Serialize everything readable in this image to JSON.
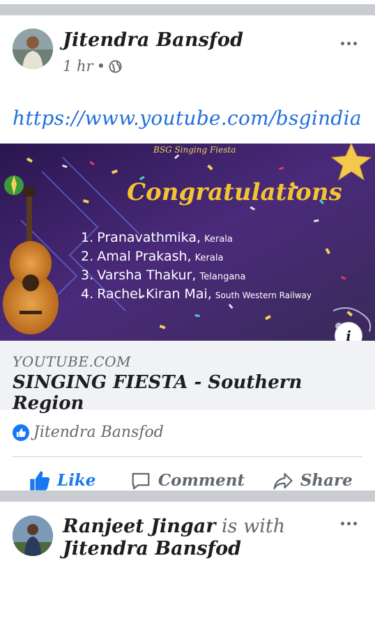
{
  "post": {
    "author": "Jitendra Bansfod",
    "time": "1 hr",
    "separator": "•",
    "link_text": "https://www.youtube.com/bsgindia",
    "preview": {
      "banner_caption": "BSG Singing Fiesta",
      "heading": "Congratulations",
      "winners": [
        {
          "rank": "1.",
          "name": "Pranavathmika,",
          "region": "Kerala"
        },
        {
          "rank": "2.",
          "name": "Amal Prakash,",
          "region": "Kerala"
        },
        {
          "rank": "3.",
          "name": "Varsha Thakur,",
          "region": "Telangana"
        },
        {
          "rank": "4.",
          "name": "Rachel Kiran Mai,",
          "region": "South Western Railway"
        }
      ],
      "info_label": "i"
    },
    "link_domain": "YOUTUBE.COM",
    "link_title": "SINGING FIESTA - Southern Region",
    "reactors": "Jitendra Bansfod",
    "actions": {
      "like": "Like",
      "comment": "Comment",
      "share": "Share"
    },
    "colors": {
      "accent": "#1877f2",
      "link": "#216fdb",
      "secondary": "#65676b"
    }
  },
  "next_post": {
    "author": "Ranjeet Jingar",
    "with_text": "is with",
    "tagged": "Jitendra Bansfod"
  }
}
